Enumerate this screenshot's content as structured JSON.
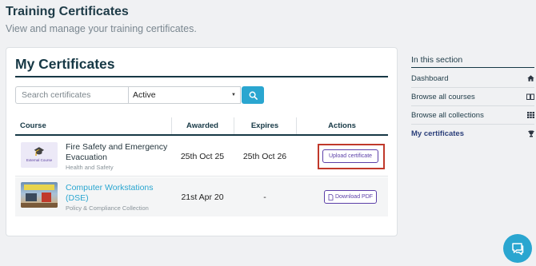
{
  "header": {
    "title": "Training Certificates",
    "subtitle": "View and manage your training certificates."
  },
  "certificates": {
    "title": "My Certificates",
    "search": {
      "placeholder": "Search certificates",
      "value": ""
    },
    "filter": {
      "selected": "Active"
    },
    "columns": [
      "Course",
      "Awarded",
      "Expires",
      "Actions"
    ],
    "rows": [
      {
        "thumb_label": "External Course",
        "name": "Fire Safety and Emergency Evacuation",
        "category": "Health and Safety",
        "awarded": "25th Oct 25",
        "expires": "25th Oct 26",
        "action": "Upload certificate"
      },
      {
        "name": "Computer Workstations (DSE)",
        "category": "Policy & Compliance Collection",
        "awarded": "21st Apr 20",
        "expires": "-",
        "action": "Download PDF"
      }
    ]
  },
  "sidebar": {
    "heading": "In this section",
    "items": [
      {
        "label": "Dashboard",
        "icon": "home-icon"
      },
      {
        "label": "Browse all courses",
        "icon": "book-icon"
      },
      {
        "label": "Browse all collections",
        "icon": "grid-icon"
      },
      {
        "label": "My certificates",
        "icon": "trophy-icon"
      }
    ]
  },
  "colors": {
    "accent": "#2aa6d0",
    "primary": "#163845",
    "action": "#5b3fa8",
    "highlight": "#c0392b"
  }
}
